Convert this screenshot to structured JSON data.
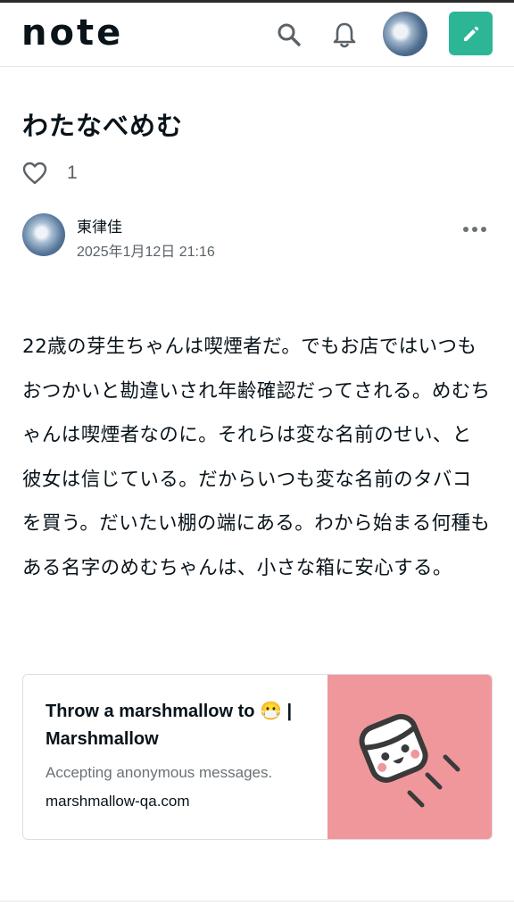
{
  "header": {
    "logo_text": "note",
    "search_icon": "search-icon",
    "bell_icon": "bell-icon",
    "post_icon": "pencil-icon",
    "accent_color": "#2cb696"
  },
  "article": {
    "title": "わたなべめむ",
    "like_count": "1",
    "author_name": "東律佳",
    "date": "2025年1月12日 21:16",
    "body": "22歳の芽生ちゃんは喫煙者だ。でもお店ではいつもおつかいと勘違いされ年齢確認だってされる。めむちゃんは喫煙者なのに。それらは変な名前のせい、と彼女は信じている。だからいつも変な名前のタバコを買う。だいたい棚の端にある。わから始まる何種もある名字のめむちゃんは、小さな箱に安心する。"
  },
  "link_card": {
    "title_part1": "Throw a marshmallow to ",
    "title_emoji": "😷",
    "title_part2": " | Marshmallow",
    "description": "Accepting anonymous messages.",
    "domain": "marshmallow-qa.com",
    "thumbnail_color": "#f0979b"
  }
}
